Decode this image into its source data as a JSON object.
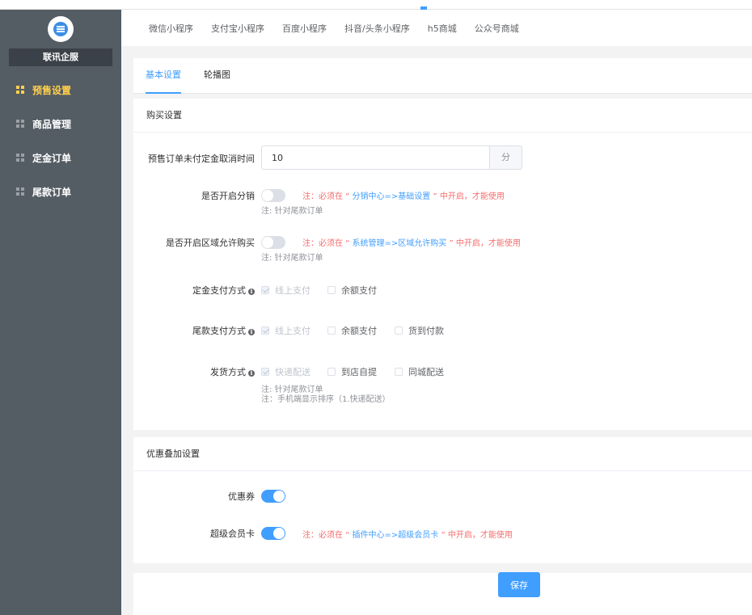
{
  "sidebar": {
    "brand": "联讯企服",
    "items": [
      {
        "label": "预售设置",
        "active": true
      },
      {
        "label": "商品管理"
      },
      {
        "label": "定金订单"
      },
      {
        "label": "尾款订单"
      }
    ]
  },
  "platforms": [
    "微信小程序",
    "支付宝小程序",
    "百度小程序",
    "抖音/头条小程序",
    "h5商城",
    "公众号商城"
  ],
  "tabs": {
    "basic": "基本设置",
    "carousel": "轮播图"
  },
  "purchase": {
    "title": "购买设置",
    "cancel_time": {
      "label": "预售订单未付定金取消时间",
      "value": "10",
      "unit": "分"
    },
    "distribution": {
      "label": "是否开启分销",
      "note_prefix": "注：必须在 “",
      "note_link": " 分销中心=>基础设置 ",
      "note_suffix": "” 中开启，才能使用",
      "sub": "注: 针对尾款订单"
    },
    "region": {
      "label": "是否开启区域允许购买",
      "note_prefix": "注：必须在 “",
      "note_link": " 系统管理=>区域允许购买 ",
      "note_suffix": "” 中开启，才能使用",
      "sub": "注: 针对尾款订单"
    },
    "deposit_pay": {
      "label": "定金支付方式",
      "opt1": "线上支付",
      "opt2": "余额支付"
    },
    "final_pay": {
      "label": "尾款支付方式",
      "opt1": "线上支付",
      "opt2": "余额支付",
      "opt3": "货到付款"
    },
    "delivery": {
      "label": "发货方式",
      "opt1": "快递配送",
      "opt2": "到店自提",
      "opt3": "同城配送",
      "note1": "注: 针对尾款订单",
      "note2": "注：手机端显示排序（1.快递配送）"
    }
  },
  "discount": {
    "title": "优惠叠加设置",
    "coupon": {
      "label": "优惠券"
    },
    "vip": {
      "label": "超级会员卡",
      "note_prefix": "注：必须在 “",
      "note_link": " 插件中心=>超级会员卡 ",
      "note_suffix": "” 中开启，才能使用"
    }
  },
  "save_label": "保存",
  "colors": {
    "accent": "#409eff",
    "sidebar": "#545c64",
    "active_menu": "#ffd04b",
    "warning": "#f56c6c"
  }
}
